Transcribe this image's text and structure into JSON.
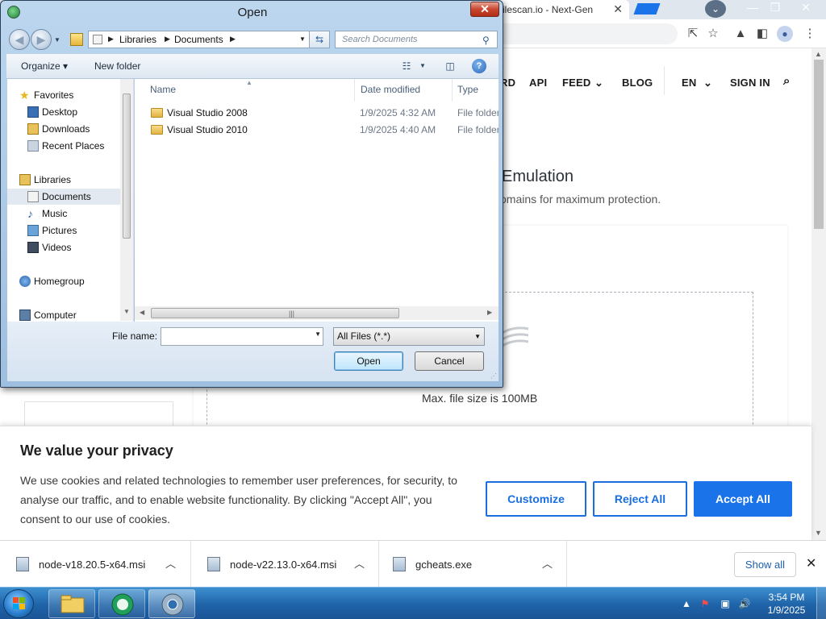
{
  "browser": {
    "tab_title": "ilescan.io - Next-Gen",
    "tab_close": "✕",
    "profile_dropdown": "⌄",
    "win_minimize": "—",
    "win_maximize": "❐",
    "win_close": "✕",
    "toolbar_icons": [
      "share-icon",
      "bookmark-star-icon",
      "extensions-icon",
      "sidepanel-icon",
      "profile-icon",
      "menu-icon"
    ]
  },
  "site": {
    "nav": {
      "dashboard_fragment": "RD",
      "api": "API",
      "feed": "FEED",
      "blog": "BLOG",
      "lang": "EN",
      "signin": "SIGN IN"
    },
    "heading_fragment": "Emulation",
    "subheading_fragment": "omains for maximum protection.",
    "max_size": "Max. file size is 100MB"
  },
  "privacy": {
    "title": "We value your privacy",
    "text": "We use cookies and related technologies to remember user preferences, for security, to analyse our traffic, and to enable website functionality. By clicking \"Accept All\", you consent to our use of cookies.",
    "customize": "Customize",
    "reject": "Reject All",
    "accept": "Accept All"
  },
  "downloads": {
    "items": [
      {
        "name": "node-v18.20.5-x64.msi"
      },
      {
        "name": "node-v22.13.0-x64.msi"
      },
      {
        "name": "gcheats.exe"
      }
    ],
    "show_all": "Show all",
    "close": "✕"
  },
  "dialog": {
    "title": "Open",
    "close": "✕",
    "breadcrumb": [
      "Libraries",
      "Documents"
    ],
    "search_placeholder": "Search Documents",
    "organize": "Organize ▾",
    "new_folder": "New folder",
    "nav": [
      {
        "label": "Favorites",
        "icon": "star-icon"
      },
      {
        "label": "Desktop",
        "icon": "desktop-icon"
      },
      {
        "label": "Downloads",
        "icon": "downloads-icon"
      },
      {
        "label": "Recent Places",
        "icon": "recent-places-icon"
      },
      {
        "label": "Libraries",
        "icon": "libraries-icon"
      },
      {
        "label": "Documents",
        "icon": "documents-icon"
      },
      {
        "label": "Music",
        "icon": "music-icon"
      },
      {
        "label": "Pictures",
        "icon": "pictures-icon"
      },
      {
        "label": "Videos",
        "icon": "videos-icon"
      },
      {
        "label": "Homegroup",
        "icon": "homegroup-icon"
      },
      {
        "label": "Computer",
        "icon": "computer-icon"
      }
    ],
    "columns": {
      "name": "Name",
      "date": "Date modified",
      "type": "Type"
    },
    "files": [
      {
        "name": "Visual Studio 2008",
        "date": "1/9/2025 4:32 AM",
        "type": "File folder"
      },
      {
        "name": "Visual Studio 2010",
        "date": "1/9/2025 4:40 AM",
        "type": "File folder"
      }
    ],
    "file_name_label": "File name:",
    "file_name_value": "",
    "filter": "All Files (*.*)",
    "open_button": "Open",
    "cancel_button": "Cancel"
  },
  "taskbar": {
    "time": "3:54 PM",
    "date": "1/9/2025",
    "tray_expand": "▲"
  },
  "colors": {
    "accent": "#1a73e8",
    "taskbar": "#1f63a8",
    "dialog_frame": "#bcd6ee"
  }
}
